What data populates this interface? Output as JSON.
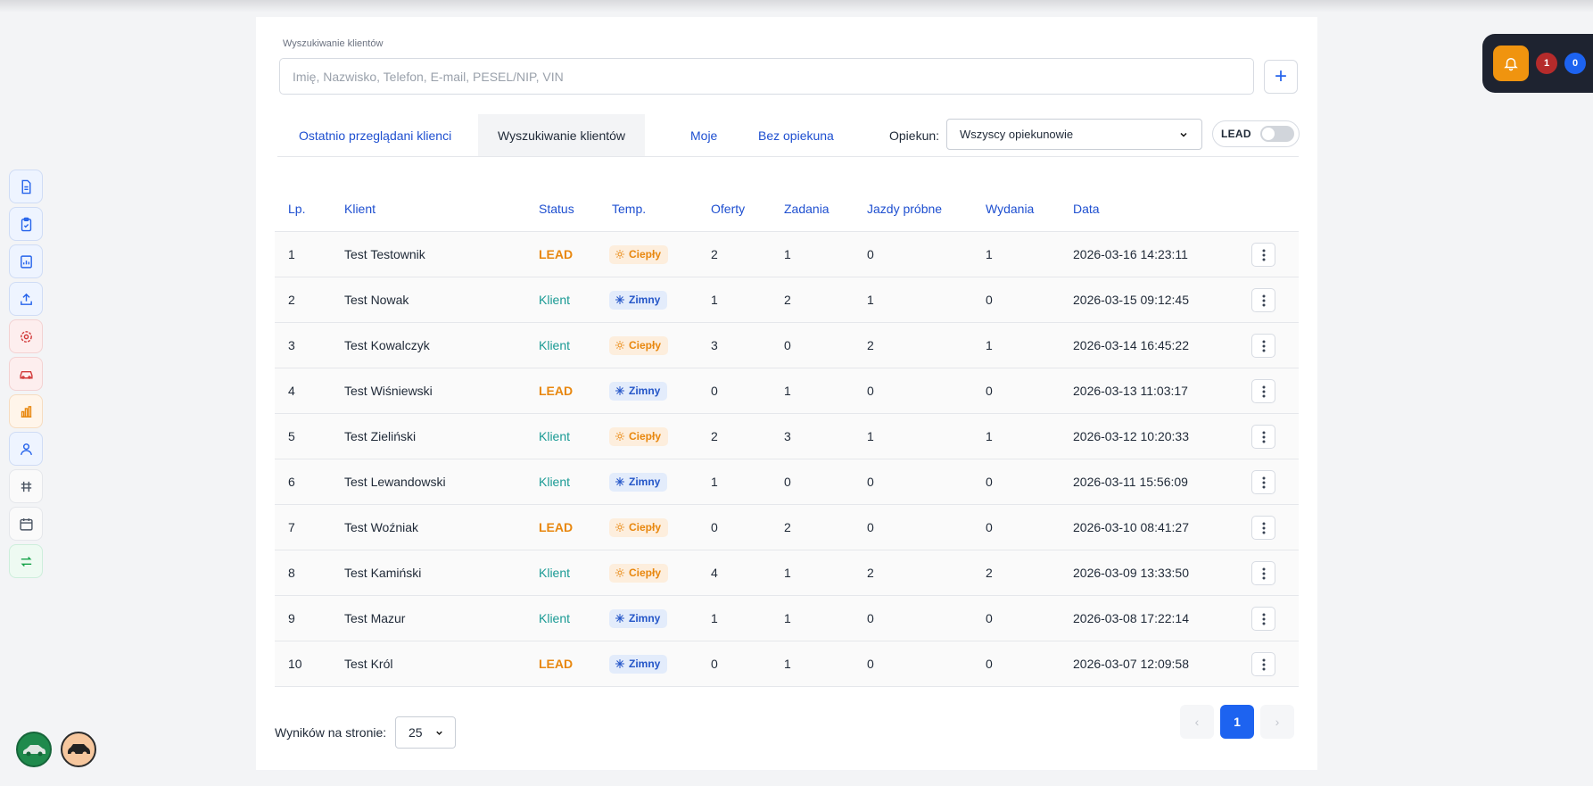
{
  "search": {
    "label": "Wyszukiwanie klientów",
    "placeholder": "Imię, Nazwisko, Telefon, E-mail, PESEL/NIP, VIN",
    "value": ""
  },
  "add_button_icon": "plus-icon",
  "tabs": [
    {
      "label": "Ostatnio przeglądani klienci",
      "active": false
    },
    {
      "label": "Wyszukiwanie klientów",
      "active": true
    },
    {
      "label": "Moje",
      "active": false
    },
    {
      "label": "Bez opiekuna",
      "active": false
    }
  ],
  "filter": {
    "opiekun_label": "Opiekun:",
    "opiekun_value": "Wszyscy opiekunowie",
    "lead_label": "LEAD",
    "lead_on": false
  },
  "table": {
    "headers": [
      "Lp.",
      "Klient",
      "Status",
      "Temp.",
      "Oferty",
      "Zadania",
      "Jazdy próbne",
      "Wydania",
      "Data"
    ],
    "rows": [
      {
        "lp": "1",
        "klient": "Test Testownik",
        "status": "LEAD",
        "temp": "Ciepły",
        "oferty": "2",
        "zadania": "1",
        "jazdy": "0",
        "wydania": "1",
        "data": "2026-03-16 14:23:11"
      },
      {
        "lp": "2",
        "klient": "Test Nowak",
        "status": "Klient",
        "temp": "Zimny",
        "oferty": "1",
        "zadania": "2",
        "jazdy": "1",
        "wydania": "0",
        "data": "2026-03-15 09:12:45"
      },
      {
        "lp": "3",
        "klient": "Test Kowalczyk",
        "status": "Klient",
        "temp": "Ciepły",
        "oferty": "3",
        "zadania": "0",
        "jazdy": "2",
        "wydania": "1",
        "data": "2026-03-14 16:45:22"
      },
      {
        "lp": "4",
        "klient": "Test Wiśniewski",
        "status": "LEAD",
        "temp": "Zimny",
        "oferty": "0",
        "zadania": "1",
        "jazdy": "0",
        "wydania": "0",
        "data": "2026-03-13 11:03:17"
      },
      {
        "lp": "5",
        "klient": "Test Zieliński",
        "status": "Klient",
        "temp": "Ciepły",
        "oferty": "2",
        "zadania": "3",
        "jazdy": "1",
        "wydania": "1",
        "data": "2026-03-12 10:20:33"
      },
      {
        "lp": "6",
        "klient": "Test Lewandowski",
        "status": "Klient",
        "temp": "Zimny",
        "oferty": "1",
        "zadania": "0",
        "jazdy": "0",
        "wydania": "0",
        "data": "2026-03-11 15:56:09"
      },
      {
        "lp": "7",
        "klient": "Test Woźniak",
        "status": "LEAD",
        "temp": "Ciepły",
        "oferty": "0",
        "zadania": "2",
        "jazdy": "0",
        "wydania": "0",
        "data": "2026-03-10 08:41:27"
      },
      {
        "lp": "8",
        "klient": "Test Kamiński",
        "status": "Klient",
        "temp": "Ciepły",
        "oferty": "4",
        "zadania": "1",
        "jazdy": "2",
        "wydania": "2",
        "data": "2026-03-09 13:33:50"
      },
      {
        "lp": "9",
        "klient": "Test Mazur",
        "status": "Klient",
        "temp": "Zimny",
        "oferty": "1",
        "zadania": "1",
        "jazdy": "0",
        "wydania": "0",
        "data": "2026-03-08 17:22:14"
      },
      {
        "lp": "10",
        "klient": "Test Król",
        "status": "LEAD",
        "temp": "Zimny",
        "oferty": "0",
        "zadania": "1",
        "jazdy": "0",
        "wydania": "0",
        "data": "2026-03-07 12:09:58"
      }
    ]
  },
  "footer": {
    "per_page_label": "Wyników na stronie:",
    "per_page_value": "25",
    "current_page": "1",
    "prev_symbol": "‹",
    "next_symbol": "›"
  },
  "notifications": {
    "count_red": "1",
    "count_blue": "0"
  },
  "sidebar_icons": [
    "document-icon",
    "clipboard-icon",
    "report-icon",
    "upload-icon",
    "gear-icon",
    "car-service-icon",
    "bar-chart-icon",
    "user-icon",
    "fuel-icon",
    "calendar-icon",
    "swap-icon"
  ],
  "colors": {
    "accent_blue": "#1e4fd0",
    "lead_orange": "#e8870e",
    "klient_teal": "#1a9a94",
    "bell_orange": "#f0940f"
  }
}
